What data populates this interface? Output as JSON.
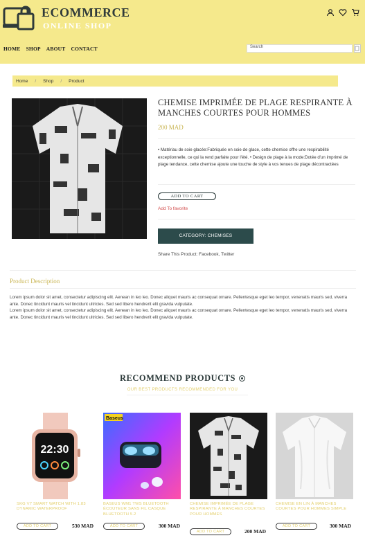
{
  "brand": {
    "title": "ECOMMERCE",
    "subtitle": "ONLINE SHOP"
  },
  "header_icons": [
    "user-icon",
    "heart-icon",
    "cart-icon"
  ],
  "nav": {
    "items": [
      "HOME",
      "SHOP",
      "ABOUT",
      "CONTACT"
    ],
    "search_placeholder": "Search"
  },
  "breadcrumb": [
    "Home",
    "Shop",
    "Product"
  ],
  "product": {
    "title": "CHEMISE IMPRIMÉE DE PLAGE RESPIRANTE À MANCHES COURTES POUR HOMMES",
    "price": "200 MAD",
    "description": "• Matériau de soie glacée:Fabriquée en soie de glace, cette chemise offre une respirabilité exceptionnelle, ce qui la rend parfaite pour l'été. • Design de plage à la mode:Dotée d'un imprimé de plage tendance, cette chemise ajoute une touche de style à vos tenues de plage décontractées",
    "add_to_cart": "ADD TO CART",
    "add_to_favorite": "Add To favorite",
    "category": "CATEGORY: CHEMISES",
    "share": "Share This Product: Facebook, Twitter"
  },
  "description_section": {
    "heading": "Product Description",
    "paragraph_1": "Lorem ipsum dolor sit amet, consectetur adipiscing elit. Aenean in leo leo. Donec aliquet mauris ac consequat ornare. Pellentesque eget leo tempor, venenatis mauris sed, viverra ante. Donec tincidunt mauris vel tincidunt ultricies. Sed sed libero hendrerit elit gravida vulputate.",
    "paragraph_2": "Lorem ipsum dolor sit amet, consectetur adipiscing elit. Aenean in leo leo. Donec aliquet mauris ac consequat ornare. Pellentesque eget leo tempor, venenatis mauris sed, viverra ante. Donec tincidunt mauris vel tincidunt ultricies. Sed sed libero hendrerit elit gravida vulputate."
  },
  "recommend": {
    "title": "RECOMMEND PRODUCTS",
    "subtitle": "OUR BEST PRODUCTS RECOMMENDED FOR YOU",
    "add_to_cart": "ADD TO CART",
    "products": [
      {
        "name": "SKG V7 SMART WATCH WITH 1.83 DYNAMIC WATERPROOF",
        "price": "530 MAD",
        "image": "smartwatch-image"
      },
      {
        "name": "BASEUS WM1 TWS BLUETOOTH ÉCOUTEUR SANS FIL CASQUE BLUETOOTH 5.2",
        "price": "300 MAD",
        "brand_tag": "Baseus",
        "image": "earbuds-image"
      },
      {
        "name": "CHEMISE IMPRIMÉE DE PLAGE RESPIRANTE À MANCHES COURTES POUR HOMMES",
        "price": "200 MAD",
        "image": "printed-shirt-image"
      },
      {
        "name": "CHEMISE EN LIN À MANCHES COURTES POUR HOMMES SIMPLE",
        "price": "300 MAD",
        "image": "linen-shirt-image"
      }
    ]
  }
}
